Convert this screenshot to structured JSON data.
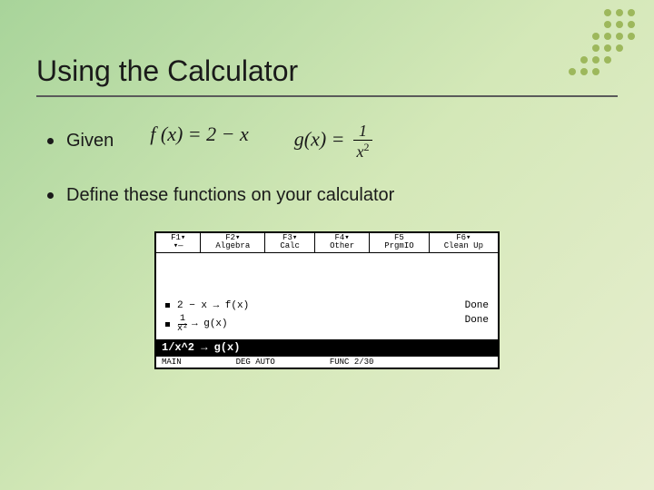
{
  "title": "Using the Calculator",
  "bullets": {
    "given": "Given",
    "define": "Define these functions on your calculator"
  },
  "formulas": {
    "f_lhs": "f (x) = 2 − x",
    "g_lhs": "g(x) =",
    "g_num": "1",
    "g_den_base": "x",
    "g_den_exp": "2"
  },
  "calc": {
    "menu": [
      {
        "key": "F1▾",
        "label": "▾—"
      },
      {
        "key": "F2▾",
        "label": "Algebra"
      },
      {
        "key": "F3▾",
        "label": "Calc"
      },
      {
        "key": "F4▾",
        "label": "Other"
      },
      {
        "key": "F5",
        "label": "PrgmIO"
      },
      {
        "key": "F6▾",
        "label": "Clean Up"
      }
    ],
    "history": [
      {
        "expr": "2 − x → f(x)",
        "result": "Done"
      },
      {
        "expr_frac": {
          "num": "1",
          "den": "x²"
        },
        "expr_tail": " → g(x)",
        "result": "Done"
      }
    ],
    "entry": "1/x^2  →  g(x)",
    "status": {
      "left": "MAIN",
      "mid": "DEG AUTO",
      "right": "FUNC 2/30"
    }
  }
}
